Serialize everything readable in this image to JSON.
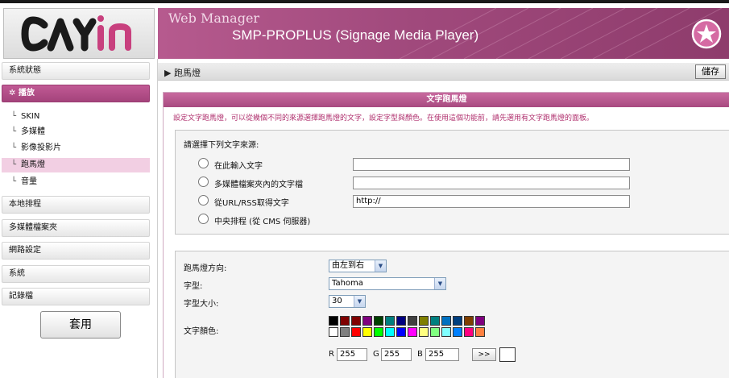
{
  "header": {
    "logo_text": "CAYIN",
    "title": "Web Manager",
    "subtitle": "SMP-PROPLUS (Signage Media Player)"
  },
  "sidebar": {
    "items": [
      {
        "label": "系統狀態"
      },
      {
        "label": "播放"
      },
      {
        "label": "SKIN"
      },
      {
        "label": "多媒體"
      },
      {
        "label": "影像投影片"
      },
      {
        "label": "跑馬燈"
      },
      {
        "label": "音量"
      },
      {
        "label": "本地排程"
      },
      {
        "label": "多媒體檔案夾"
      },
      {
        "label": "網路設定"
      },
      {
        "label": "系統"
      },
      {
        "label": "記錄檔"
      }
    ],
    "apply_label": "套用"
  },
  "toolbar": {
    "breadcrumb": "跑馬燈",
    "save_label": "儲存"
  },
  "panel": {
    "title": "文字跑馬燈",
    "description": "設定文字跑馬燈，可以從幾個不同的來源選擇跑馬燈的文字，設定字型與顏色。在使用這個功能前，請先選用有文字跑馬燈的面板。"
  },
  "source": {
    "heading": "請選擇下列文字來源:",
    "options": [
      {
        "label": "在此輸入文字",
        "value": ""
      },
      {
        "label": "多媒體檔案夾內的文字檔",
        "value": ""
      },
      {
        "label": "從URL/RSS取得文字",
        "value": "http://"
      },
      {
        "label": "中央排程 (從 CMS 伺服器)"
      }
    ]
  },
  "settings": {
    "direction_label": "跑馬燈方向:",
    "direction_value": "由左到右",
    "font_label": "字型:",
    "font_value": "Tahoma",
    "size_label": "字型大小:",
    "size_value": "30",
    "color_label": "文字顏色:",
    "r_label": "R",
    "r_value": "255",
    "g_label": "G",
    "g_value": "255",
    "b_label": "B",
    "b_value": "255",
    "apply_color_label": ">>"
  },
  "palette_colors": [
    [
      "#000000",
      "#7f0000",
      "#800000",
      "#7f007f",
      "#004000",
      "#007f7f",
      "#00007f",
      "#404040",
      "#7f7f00",
      "#008080",
      "#0070c0",
      "#003f7f",
      "#7f3f00",
      "#7f007f"
    ],
    [
      "#ffffff",
      "#808080",
      "#ff0000",
      "#ffff00",
      "#00ff00",
      "#00ffff",
      "#0000ff",
      "#ff00ff",
      "#ffff80",
      "#80ff80",
      "#80ffff",
      "#0080ff",
      "#ff0080",
      "#ff8040"
    ]
  ],
  "colors": {
    "brand": "#a84a80",
    "description": "#b0306e"
  }
}
